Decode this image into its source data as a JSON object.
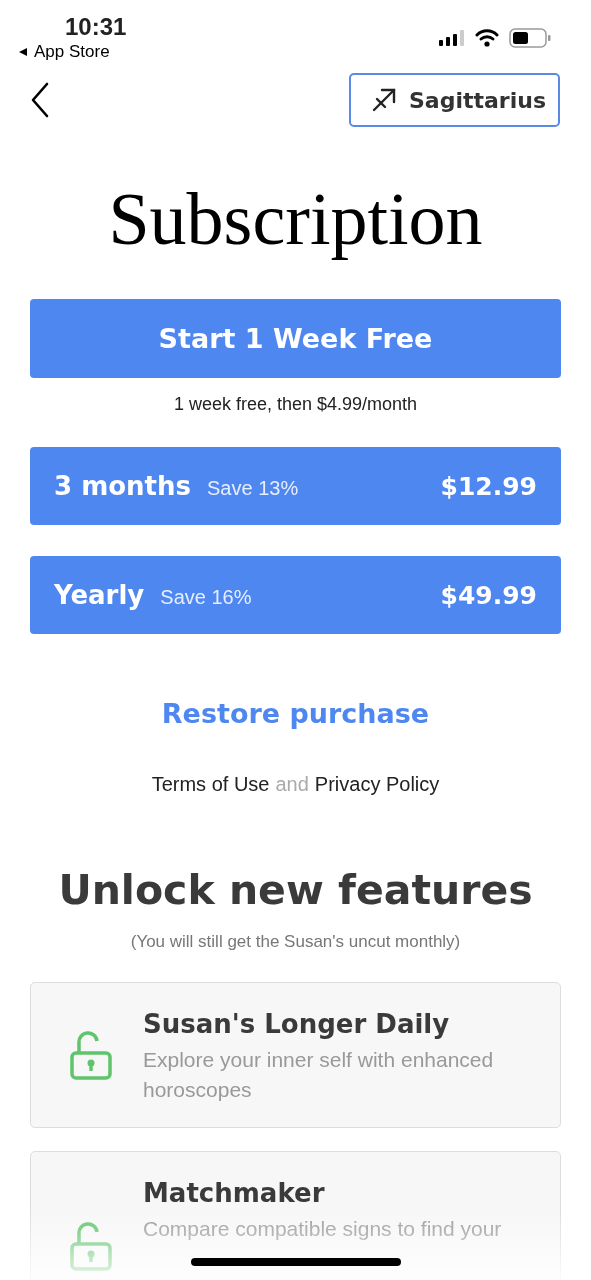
{
  "status_bar": {
    "time": "10:31",
    "back_label": "App Store"
  },
  "nav": {
    "sign_button": "Sagittarius"
  },
  "title": "Subscription",
  "trial": {
    "label": "Start 1 Week Free",
    "note": "1 week free, then $4.99/month"
  },
  "plans": [
    {
      "name": "3 months",
      "saving": "Save 13%",
      "price": "$12.99"
    },
    {
      "name": "Yearly",
      "saving": "Save 16%",
      "price": "$49.99"
    }
  ],
  "restore": "Restore purchase",
  "legal": {
    "terms": "Terms of Use",
    "joiner": "and",
    "privacy": "Privacy Policy"
  },
  "features": {
    "heading": "Unlock new features",
    "note": "(You will still get the Susan's uncut monthly)",
    "items": [
      {
        "title": "Susan's Longer Daily",
        "description": "Explore your inner self with enhanced horoscopes"
      },
      {
        "title": "Matchmaker",
        "description": "Compare compatible signs to find your"
      }
    ]
  }
}
